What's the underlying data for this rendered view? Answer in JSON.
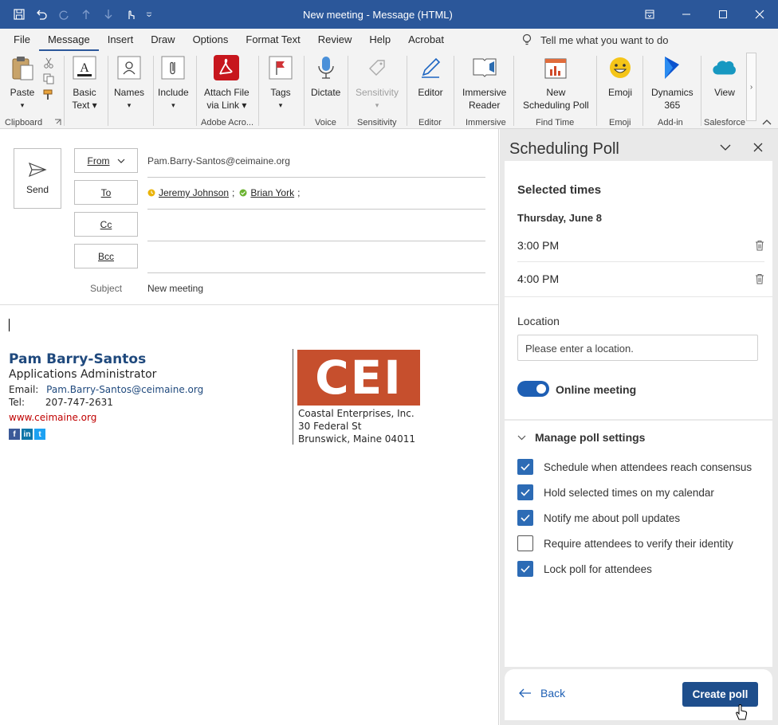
{
  "window": {
    "title": "New meeting  -  Message (HTML)"
  },
  "menu": {
    "tabs": [
      "File",
      "Message",
      "Insert",
      "Draw",
      "Options",
      "Format Text",
      "Review",
      "Help",
      "Acrobat"
    ],
    "active": "Message",
    "tell_me": "Tell me what you want to do"
  },
  "ribbon": {
    "paste": "Paste",
    "basic_text_1": "Basic",
    "basic_text_2": "Text",
    "names": "Names",
    "include": "Include",
    "attach_1": "Attach File",
    "attach_2": "via Link",
    "tags": "Tags",
    "dictate": "Dictate",
    "sensitivity": "Sensitivity",
    "editor": "Editor",
    "immersive_1": "Immersive",
    "immersive_2": "Reader",
    "sched_1": "New",
    "sched_2": "Scheduling Poll",
    "emoji": "Emoji",
    "dynamics_1": "Dynamics",
    "dynamics_2": "365",
    "view": "View",
    "groups": {
      "clipboard": "Clipboard",
      "adobe": "Adobe Acro...",
      "voice": "Voice",
      "sensitivity": "Sensitivity",
      "editor": "Editor",
      "immersive": "Immersive",
      "find_time": "Find Time",
      "emoji": "Emoji",
      "addin": "Add-in",
      "salesforce": "Salesforce"
    }
  },
  "compose": {
    "send": "Send",
    "from_label": "From",
    "from_value": "Pam.Barry-Santos@ceimaine.org",
    "to_label": "To",
    "recipients": [
      "Jeremy Johnson",
      "Brian York"
    ],
    "cc_label": "Cc",
    "bcc_label": "Bcc",
    "subject_label": "Subject",
    "subject_value": "New meeting"
  },
  "signature": {
    "name": "Pam Barry-Santos",
    "role": "Applications Administrator",
    "email_label": "Email:",
    "email": "Pam.Barry-Santos@ceimaine.org",
    "tel_label": "Tel:",
    "tel": "207-747-2631",
    "website": "www.ceimaine.org",
    "logo_text": "CEI",
    "company": "Coastal Enterprises, Inc.",
    "street": "30 Federal St",
    "city": "Brunswick, Maine 04011"
  },
  "poll": {
    "title": "Scheduling Poll",
    "selected_heading": "Selected times",
    "date": "Thursday, June 8",
    "times": [
      "3:00 PM",
      "4:00 PM"
    ],
    "location_label": "Location",
    "location_placeholder": "Please enter a location.",
    "online_label": "Online meeting",
    "settings_heading": "Manage poll settings",
    "settings": [
      {
        "label": "Schedule when attendees reach consensus",
        "checked": true
      },
      {
        "label": "Hold selected times on my calendar",
        "checked": true
      },
      {
        "label": "Notify me about poll updates",
        "checked": true
      },
      {
        "label": "Require attendees to verify their identity",
        "checked": false
      },
      {
        "label": "Lock poll for attendees",
        "checked": true
      }
    ],
    "back": "Back",
    "create": "Create poll"
  },
  "colors": {
    "accent": "#2b579a",
    "button": "#1e4e8c",
    "cei": "#c64f2d",
    "sig_name": "#1f497d",
    "website": "#c00000"
  }
}
